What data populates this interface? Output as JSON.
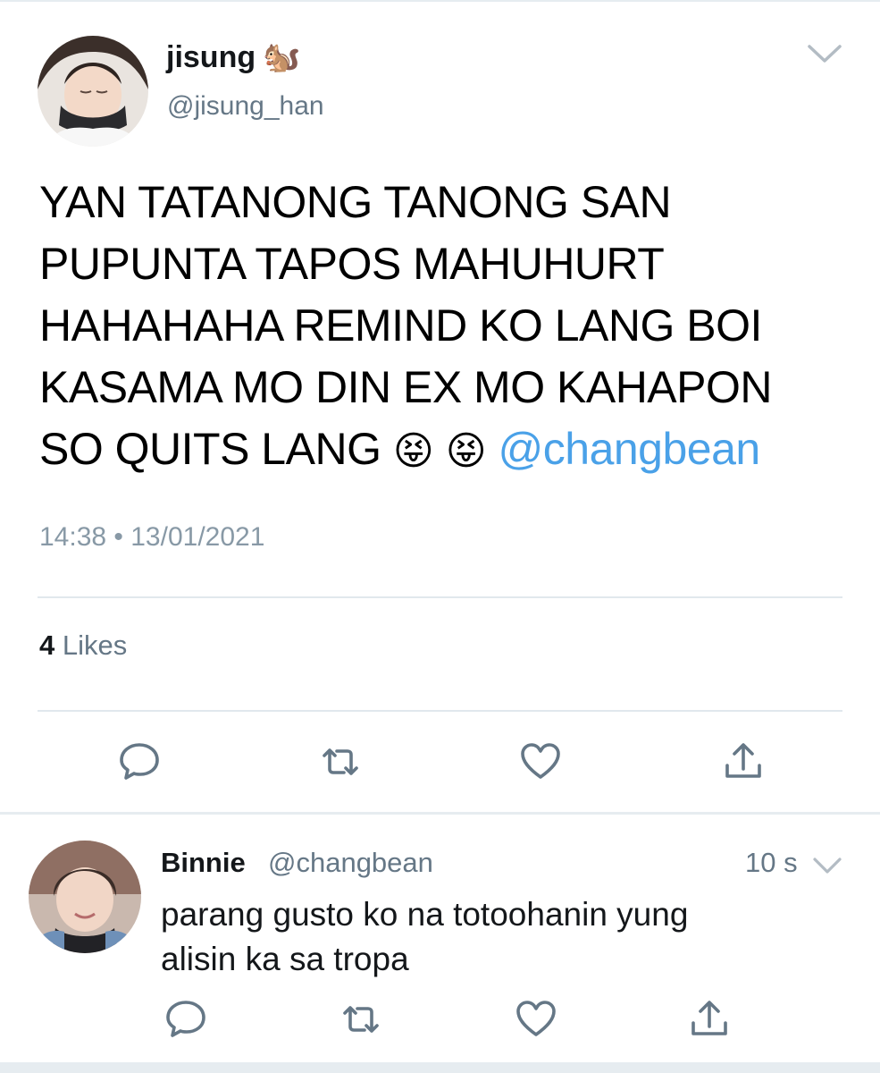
{
  "tweet": {
    "author": {
      "display_name": "jisung",
      "name_emoji": "🐿️",
      "handle": "@jisung_han"
    },
    "text_lines": [
      "YAN TATANONG TANONG SAN",
      "PUPUNTA TAPOS MAHUHURT",
      "HAHAHAHA REMIND KO LANG BOI",
      "KASAMA MO DIN EX MO KAHAPON"
    ],
    "last_line_text": "SO QUITS LANG ",
    "last_line_emojis": "😝 😝",
    "mention": "@changbean",
    "timestamp": "14:38 • 13/01/2021",
    "likes_count": "4",
    "likes_label": "Likes"
  },
  "reply": {
    "display_name": "Binnie",
    "handle": "@changbean",
    "time": "10 s",
    "text_lines": [
      "parang gusto ko na totoohanin yung",
      "alisin ka sa tropa"
    ]
  },
  "icons": {
    "reply": "reply-icon",
    "retweet": "retweet-icon",
    "like": "heart-icon",
    "share": "share-icon",
    "more": "chevron-down-icon"
  },
  "colors": {
    "mention": "#4aa1e8",
    "secondary_text": "#657786",
    "icon": "#657786"
  }
}
